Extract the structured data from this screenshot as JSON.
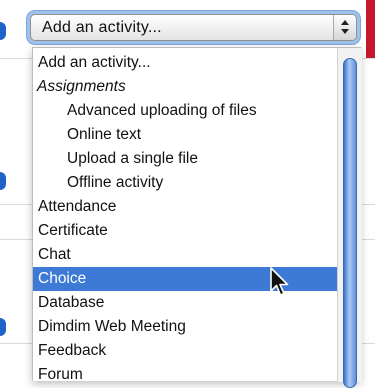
{
  "select": {
    "value": "Add an activity..."
  },
  "options": [
    {
      "label": "Add an activity...",
      "kind": "option"
    },
    {
      "label": "Assignments",
      "kind": "group"
    },
    {
      "label": "Advanced uploading of files",
      "kind": "indent"
    },
    {
      "label": "Online text",
      "kind": "indent"
    },
    {
      "label": "Upload a single file",
      "kind": "indent"
    },
    {
      "label": "Offline activity",
      "kind": "indent"
    },
    {
      "label": "Attendance",
      "kind": "option"
    },
    {
      "label": "Certificate",
      "kind": "option"
    },
    {
      "label": "Chat",
      "kind": "option"
    },
    {
      "label": "Choice",
      "kind": "option",
      "selected": true
    },
    {
      "label": "Database",
      "kind": "option"
    },
    {
      "label": "Dimdim Web Meeting",
      "kind": "option"
    },
    {
      "label": "Feedback",
      "kind": "option"
    },
    {
      "label": "Forum",
      "kind": "option"
    }
  ],
  "icons": {
    "select_arrows": "up-down-arrows-icon",
    "cursor": "mouse-pointer-icon"
  },
  "colors": {
    "selection": "#3c7ad6",
    "focus_ring": "#9fc2ec",
    "accent_strip": "#c5172e",
    "bullet": "#1f62c9"
  }
}
